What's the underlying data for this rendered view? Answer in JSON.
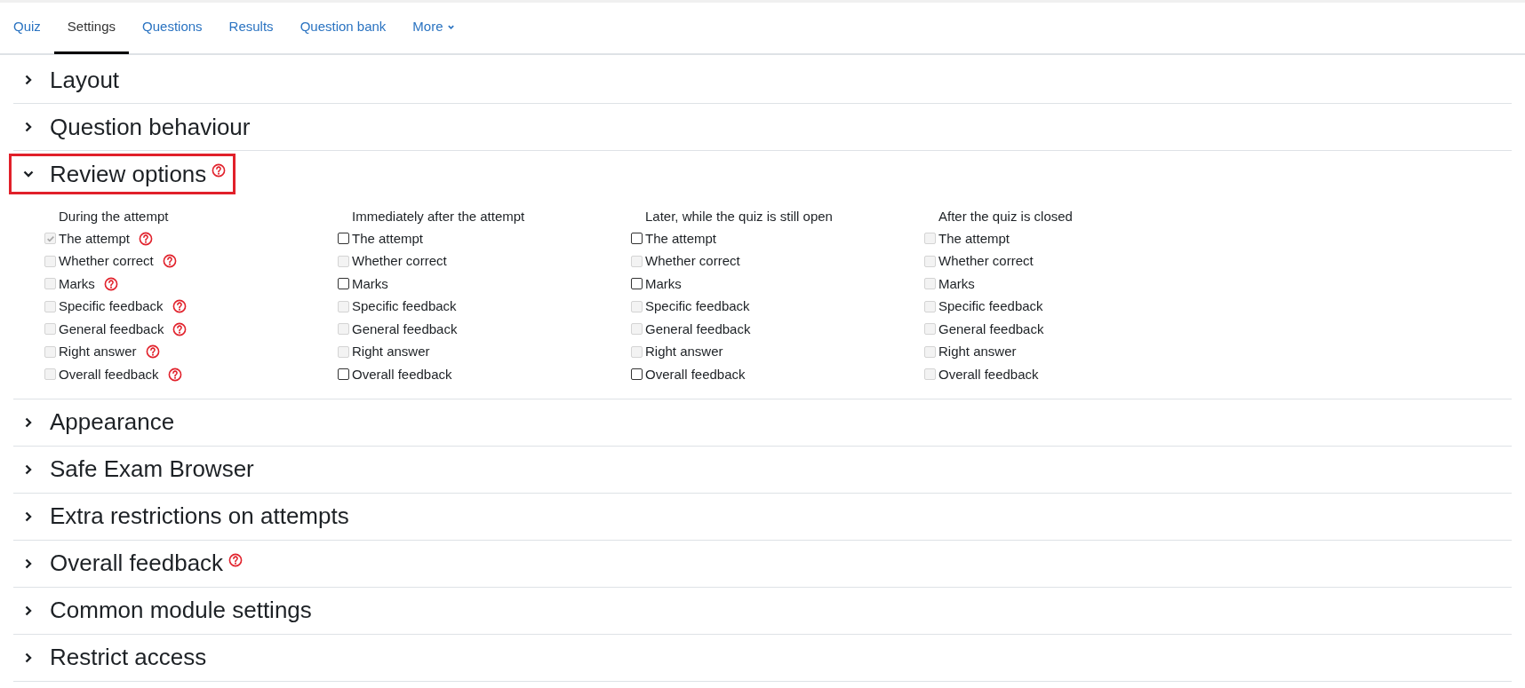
{
  "tabs": [
    {
      "label": "Quiz",
      "selected": false
    },
    {
      "label": "Settings",
      "selected": true
    },
    {
      "label": "Questions",
      "selected": false
    },
    {
      "label": "Results",
      "selected": false
    },
    {
      "label": "Question bank",
      "selected": false
    },
    {
      "label": "More",
      "selected": false,
      "dropdown": true
    }
  ],
  "sections": [
    {
      "title": "Layout",
      "expanded": false,
      "help": false,
      "highlighted": false
    },
    {
      "title": "Question behaviour",
      "expanded": false,
      "help": false,
      "highlighted": false
    },
    {
      "title": "Review options",
      "expanded": true,
      "help": true,
      "highlighted": true,
      "columns": [
        {
          "heading": "During the attempt",
          "options": [
            {
              "label": "The attempt",
              "checked": true,
              "disabled": true,
              "help": true
            },
            {
              "label": "Whether correct",
              "checked": false,
              "disabled": true,
              "help": true
            },
            {
              "label": "Marks",
              "checked": false,
              "disabled": true,
              "help": true
            },
            {
              "label": "Specific feedback",
              "checked": false,
              "disabled": true,
              "help": true
            },
            {
              "label": "General feedback",
              "checked": false,
              "disabled": true,
              "help": true
            },
            {
              "label": "Right answer",
              "checked": false,
              "disabled": true,
              "help": true
            },
            {
              "label": "Overall feedback",
              "checked": false,
              "disabled": true,
              "help": true
            }
          ]
        },
        {
          "heading": "Immediately after the attempt",
          "options": [
            {
              "label": "The attempt",
              "checked": false,
              "disabled": false,
              "help": false
            },
            {
              "label": "Whether correct",
              "checked": false,
              "disabled": true,
              "help": false
            },
            {
              "label": "Marks",
              "checked": false,
              "disabled": false,
              "help": false
            },
            {
              "label": "Specific feedback",
              "checked": false,
              "disabled": true,
              "help": false
            },
            {
              "label": "General feedback",
              "checked": false,
              "disabled": true,
              "help": false
            },
            {
              "label": "Right answer",
              "checked": false,
              "disabled": true,
              "help": false
            },
            {
              "label": "Overall feedback",
              "checked": false,
              "disabled": false,
              "help": false
            }
          ]
        },
        {
          "heading": "Later, while the quiz is still open",
          "options": [
            {
              "label": "The attempt",
              "checked": false,
              "disabled": false,
              "help": false
            },
            {
              "label": "Whether correct",
              "checked": false,
              "disabled": true,
              "help": false
            },
            {
              "label": "Marks",
              "checked": false,
              "disabled": false,
              "help": false
            },
            {
              "label": "Specific feedback",
              "checked": false,
              "disabled": true,
              "help": false
            },
            {
              "label": "General feedback",
              "checked": false,
              "disabled": true,
              "help": false
            },
            {
              "label": "Right answer",
              "checked": false,
              "disabled": true,
              "help": false
            },
            {
              "label": "Overall feedback",
              "checked": false,
              "disabled": false,
              "help": false
            }
          ]
        },
        {
          "heading": "After the quiz is closed",
          "options": [
            {
              "label": "The attempt",
              "checked": false,
              "disabled": true,
              "help": false
            },
            {
              "label": "Whether correct",
              "checked": false,
              "disabled": true,
              "help": false
            },
            {
              "label": "Marks",
              "checked": false,
              "disabled": true,
              "help": false
            },
            {
              "label": "Specific feedback",
              "checked": false,
              "disabled": true,
              "help": false
            },
            {
              "label": "General feedback",
              "checked": false,
              "disabled": true,
              "help": false
            },
            {
              "label": "Right answer",
              "checked": false,
              "disabled": true,
              "help": false
            },
            {
              "label": "Overall feedback",
              "checked": false,
              "disabled": true,
              "help": false
            }
          ]
        }
      ]
    },
    {
      "title": "Appearance",
      "expanded": false,
      "help": false,
      "highlighted": false
    },
    {
      "title": "Safe Exam Browser",
      "expanded": false,
      "help": false,
      "highlighted": false
    },
    {
      "title": "Extra restrictions on attempts",
      "expanded": false,
      "help": false,
      "highlighted": false
    },
    {
      "title": "Overall feedback",
      "expanded": false,
      "help": true,
      "highlighted": false
    },
    {
      "title": "Common module settings",
      "expanded": false,
      "help": false,
      "highlighted": false
    },
    {
      "title": "Restrict access",
      "expanded": false,
      "help": false,
      "highlighted": false
    }
  ]
}
